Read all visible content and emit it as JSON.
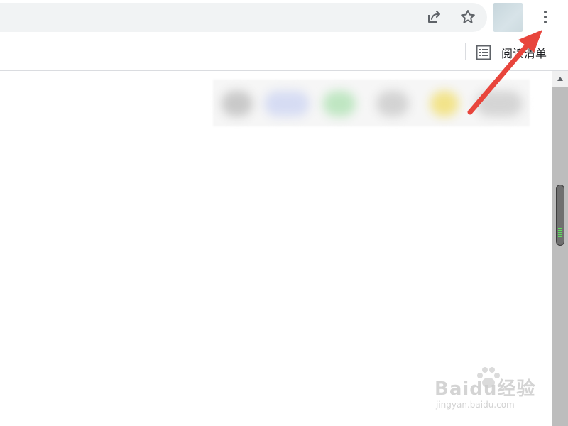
{
  "toolbar": {
    "share_icon": "share-icon",
    "bookmark_star_icon": "star-icon",
    "profile": "profile-avatar",
    "menu_icon": "kebab-menu-icon"
  },
  "bookmarks_bar": {
    "reading_list_label": "阅读清单",
    "reading_list_icon": "reading-list-icon"
  },
  "annotation": {
    "arrow_color": "#e8453c",
    "points_to": "kebab-menu-icon"
  },
  "watermark": {
    "brand": "Baidu经验",
    "url": "jingyan.baidu.com"
  },
  "colors": {
    "omnibox_bg": "#f1f3f4",
    "icon": "#5f6368",
    "scrollbar": "#bdbdbd",
    "scroll_thumb_grip": "#5be15b"
  }
}
